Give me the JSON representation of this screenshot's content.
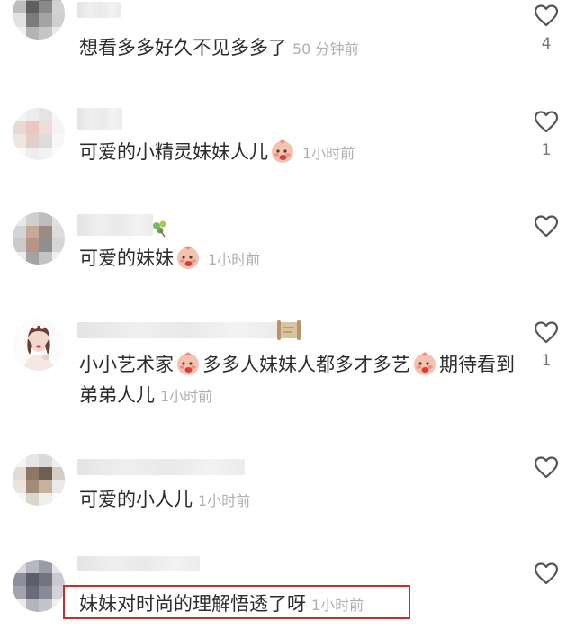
{
  "comments": [
    {
      "text": "想看多多好久不见多多了",
      "time": "50 分钟前",
      "likes": "4"
    },
    {
      "text_before": "可爱的小精灵妹妹人儿",
      "emoji": "shy-face-emoji",
      "time": "1小时前",
      "likes": "1"
    },
    {
      "text_before": "可爱的妹妹",
      "emoji": "shy-face-emoji",
      "time": "1小时前",
      "likes": ""
    },
    {
      "part1": "小小艺术家",
      "part2": "多多人妹妹人都多才多艺",
      "part3": "期待看到弟弟人儿",
      "emoji": "shy-face-emoji",
      "time": "1小时前",
      "likes": "1"
    },
    {
      "text": "可爱的小人儿",
      "time": "1小时前",
      "likes": ""
    },
    {
      "text": "妹妹对时尚的理解悟透了呀",
      "time": "1小时前",
      "likes": ""
    }
  ],
  "icons": {
    "like": "heart-outline-icon",
    "emoji": "shy-face-emoji"
  },
  "colors": {
    "text": "#2b2b2b",
    "timestamp": "#b0b0b0",
    "like_icon": "#555555",
    "highlight_border": "#d62828"
  }
}
